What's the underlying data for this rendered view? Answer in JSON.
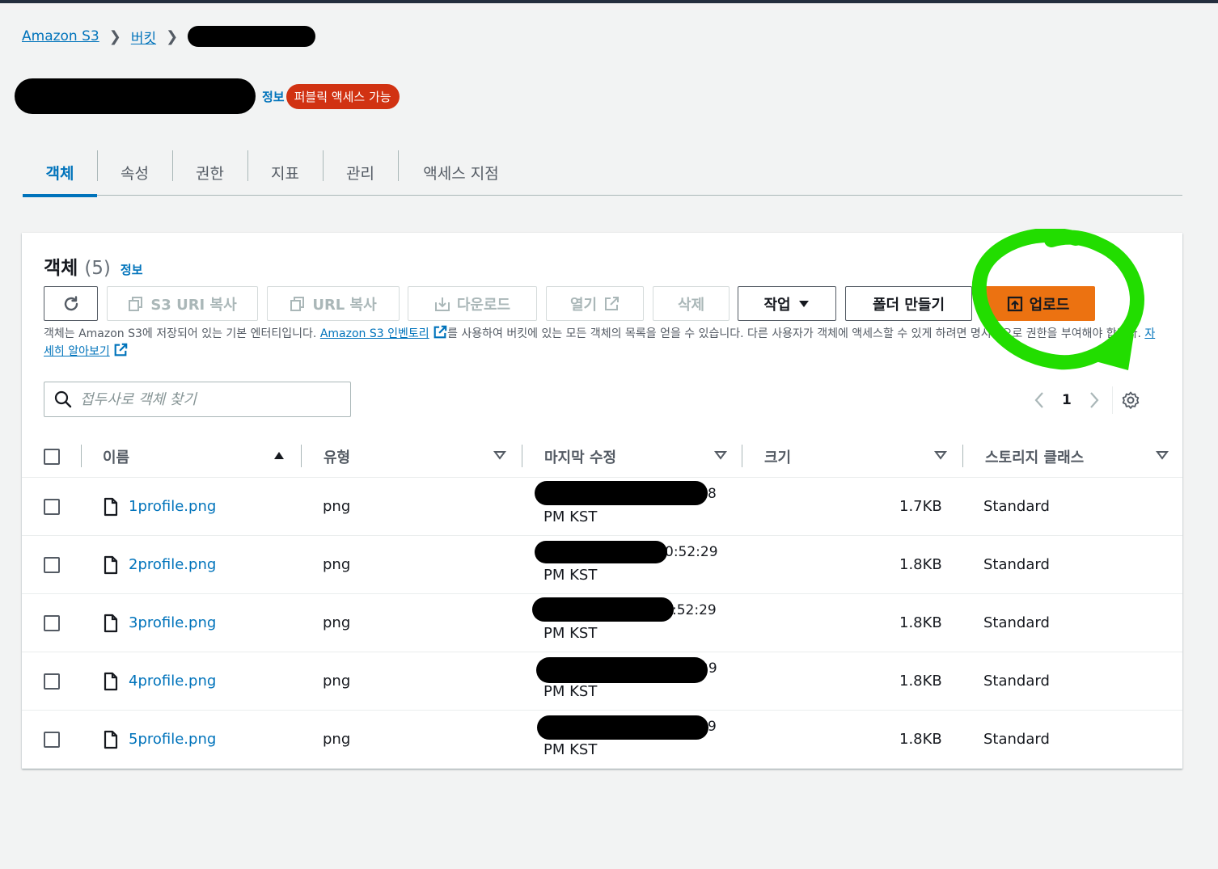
{
  "breadcrumb": {
    "s3": "Amazon S3",
    "buckets": "버킷"
  },
  "header": {
    "info": "정보",
    "public_badge": "퍼블릭 액세스 가능"
  },
  "tabs": [
    "객체",
    "속성",
    "권한",
    "지표",
    "관리",
    "액세스 지점"
  ],
  "objects_panel": {
    "title": "객체",
    "count": "(5)",
    "info": "정보",
    "buttons": {
      "copy_s3_uri": "S3 URI 복사",
      "copy_url": "URL 복사",
      "download": "다운로드",
      "open": "열기",
      "delete": "삭제",
      "actions": "작업",
      "create_folder": "폴더 만들기",
      "upload": "업로드"
    },
    "description": {
      "part1": "객체는 Amazon S3에 저장되어 있는 기본 엔터티입니다. ",
      "link1": "Amazon S3 인벤토리",
      "part2": "를 사용하여 버킷에 있는 모든 객체의 목록을 얻을 수 있습니다. 다른 사용자가 객체에 액세스할 수 있게 하려면 명시적으로 권한을 부여해야 합니다. ",
      "link2": "자세히 알아보기"
    },
    "search_placeholder": "접두사로 객체 찾기",
    "pagination": {
      "current_page": "1"
    },
    "columns": {
      "name": "이름",
      "type": "유형",
      "last_modified": "마지막 수정",
      "size": "크기",
      "storage_class": "스토리지 클래스"
    },
    "rows": [
      {
        "name": "1profile.png",
        "type": "png",
        "modified_visible": "8",
        "modified_suffix": "PM KST",
        "size": "1.7KB",
        "storage_class": "Standard"
      },
      {
        "name": "2profile.png",
        "type": "png",
        "modified_visible": "0:52:29",
        "modified_suffix": "PM KST",
        "size": "1.8KB",
        "storage_class": "Standard"
      },
      {
        "name": "3profile.png",
        "type": "png",
        "modified_visible": ":52:29",
        "modified_suffix": "PM KST",
        "size": "1.8KB",
        "storage_class": "Standard"
      },
      {
        "name": "4profile.png",
        "type": "png",
        "modified_visible": "29",
        "modified_suffix": "PM KST",
        "size": "1.8KB",
        "storage_class": "Standard"
      },
      {
        "name": "5profile.png",
        "type": "png",
        "modified_visible": "9",
        "modified_suffix": "PM KST",
        "size": "1.8KB",
        "storage_class": "Standard"
      }
    ]
  },
  "colors": {
    "link": "#0073bb",
    "primary_button": "#ec7211",
    "public_badge": "#d13212",
    "annotation": "#22dd00"
  }
}
